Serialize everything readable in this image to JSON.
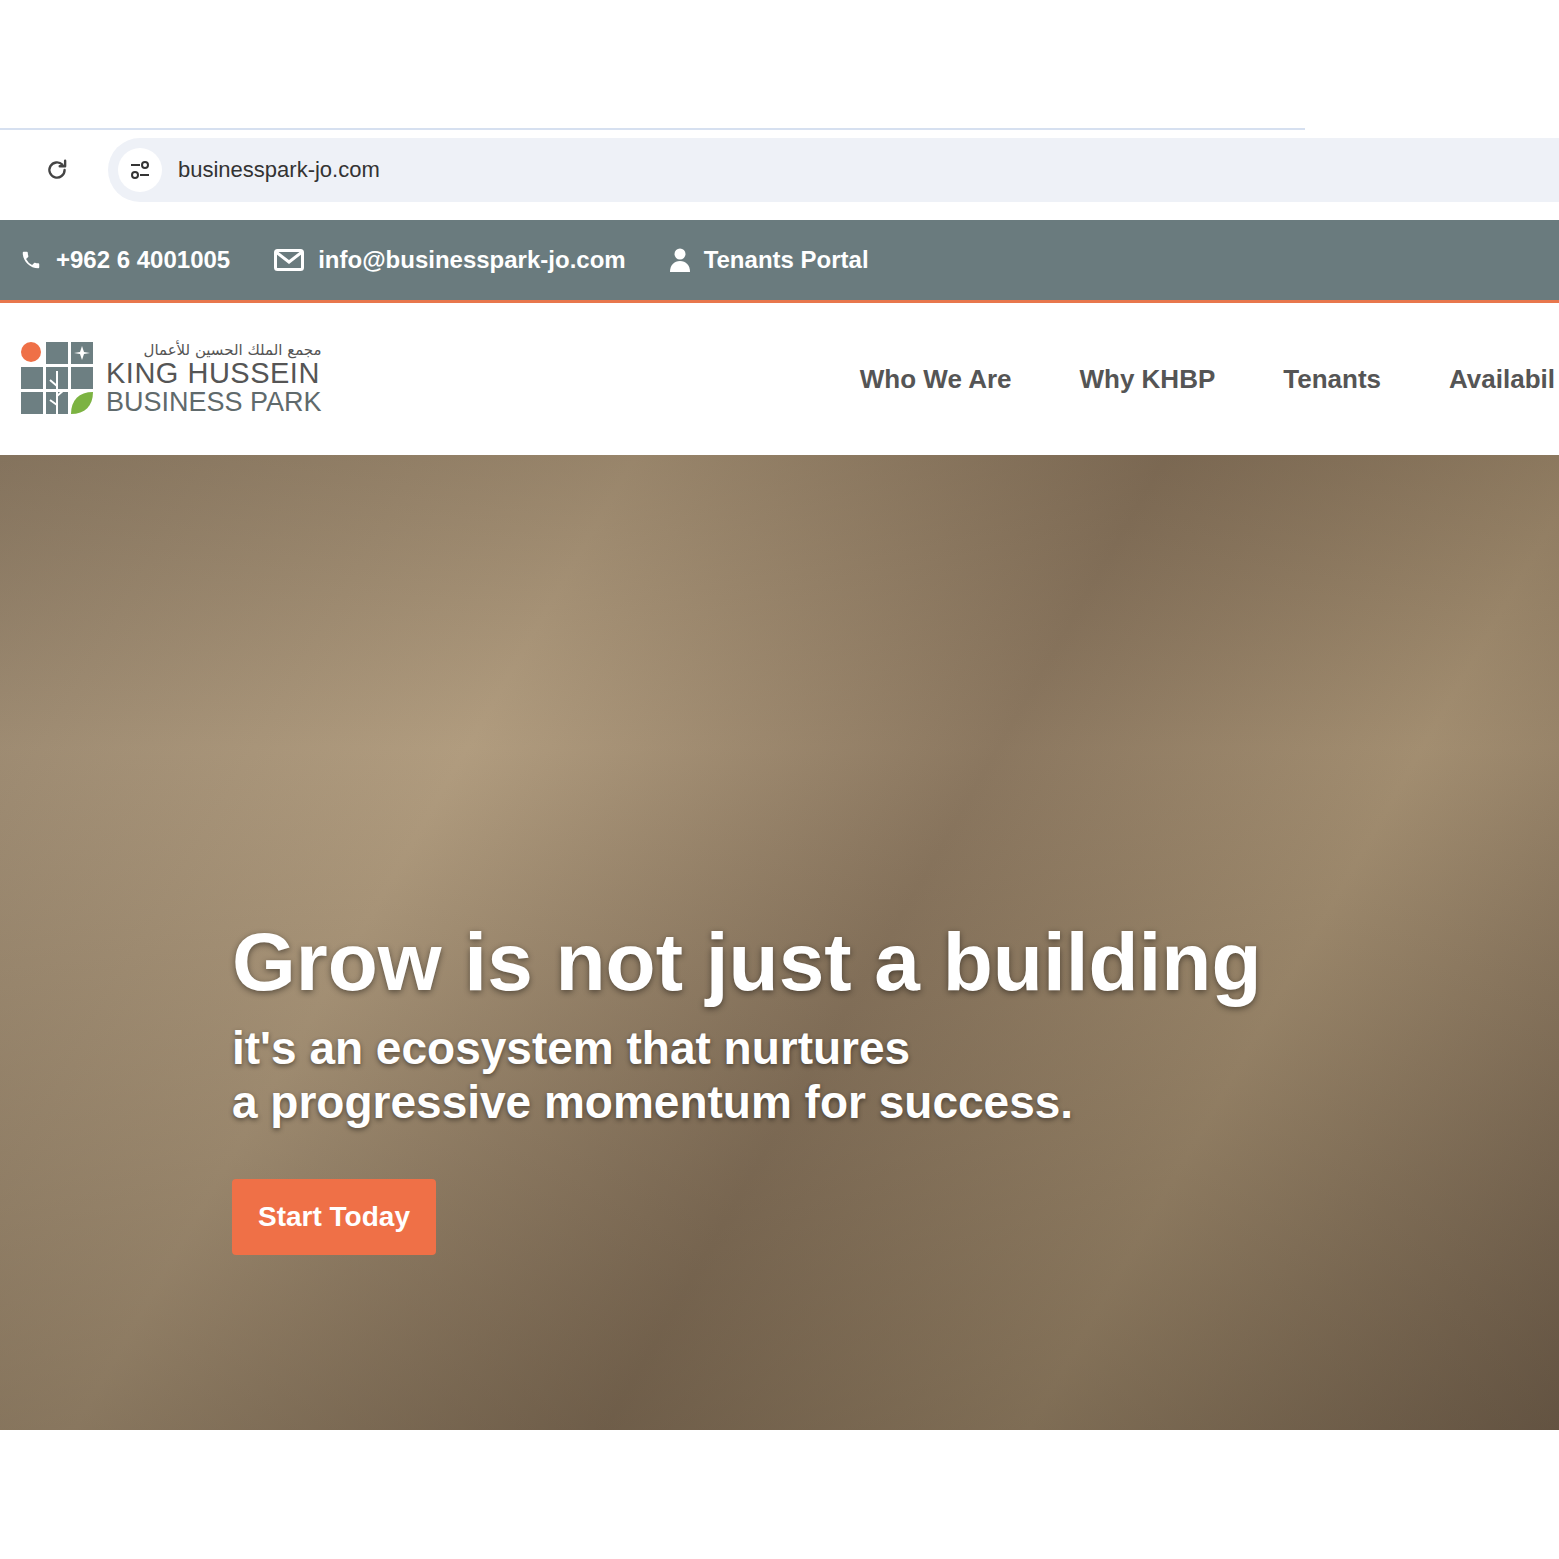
{
  "browser": {
    "url": "businesspark-jo.com"
  },
  "topbar": {
    "phone": "+962 6 4001005",
    "email": "info@businesspark-jo.com",
    "portal": "Tenants Portal"
  },
  "logo": {
    "arabic": "مجمع الملك الحسين للأعمال",
    "line1": "KING HUSSEIN",
    "line2": "BUSINESS PARK"
  },
  "nav": [
    {
      "label": "Who We Are"
    },
    {
      "label": "Why KHBP"
    },
    {
      "label": "Tenants"
    },
    {
      "label": "Availabil"
    }
  ],
  "hero": {
    "title": "Grow is not just a building",
    "lines": [
      "it's an ecosystem that nurtures",
      "a progressive momentum for success."
    ],
    "button": "Start Today"
  }
}
